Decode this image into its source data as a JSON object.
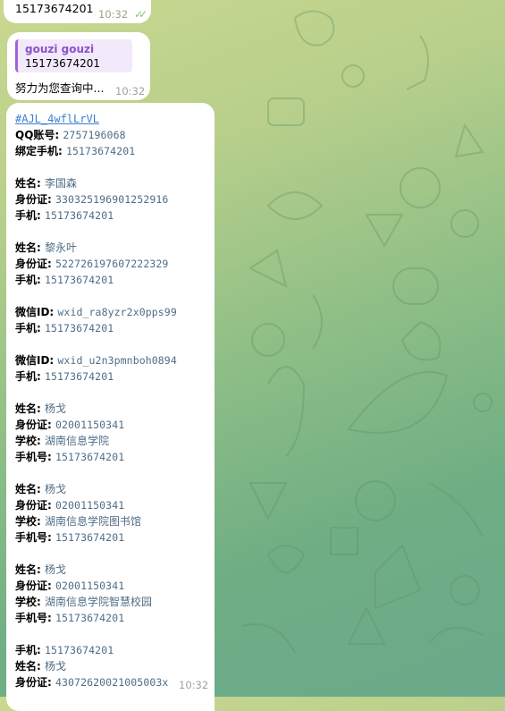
{
  "colors": {
    "accent": "#3b7fd0",
    "reply_bar": "#9d66d8",
    "reply_name": "#8b52c9",
    "value_text": "#4f6d86"
  },
  "msg1": {
    "text": "15173674201",
    "time": "10:32",
    "status_icon": "double-check-icon"
  },
  "msg2": {
    "reply_name": "gouzi gouzi",
    "reply_text": "15173674201",
    "text": "努力为您查询中...",
    "time": "10:32"
  },
  "msg3": {
    "hashtag": "#AJL_4wflLrVL",
    "time": "10:32",
    "lines": [
      {
        "label": "QQ账号: ",
        "value": "2757196068"
      },
      {
        "label": "绑定手机: ",
        "value": "15173674201"
      },
      {
        "label": "",
        "value": ""
      },
      {
        "label": "姓名: ",
        "value": "李国森"
      },
      {
        "label": "身份证: ",
        "value": "330325196901252916"
      },
      {
        "label": "手机: ",
        "value": "15173674201"
      },
      {
        "label": "",
        "value": ""
      },
      {
        "label": "姓名: ",
        "value": "黎永叶"
      },
      {
        "label": "身份证: ",
        "value": "522726197607222329"
      },
      {
        "label": "手机: ",
        "value": "15173674201"
      },
      {
        "label": "",
        "value": ""
      },
      {
        "label": "微信ID: ",
        "value": "wxid_ra8yzr2x0pps99"
      },
      {
        "label": "手机: ",
        "value": "15173674201"
      },
      {
        "label": "",
        "value": ""
      },
      {
        "label": "微信ID: ",
        "value": "wxid_u2n3pmnboh0894"
      },
      {
        "label": "手机: ",
        "value": "15173674201"
      },
      {
        "label": "",
        "value": ""
      },
      {
        "label": "姓名: ",
        "value": "杨戈"
      },
      {
        "label": "身份证: ",
        "value": "02001150341"
      },
      {
        "label": "学校: ",
        "value": "湖南信息学院"
      },
      {
        "label": "手机号: ",
        "value": "15173674201"
      },
      {
        "label": "",
        "value": ""
      },
      {
        "label": "姓名: ",
        "value": "杨戈"
      },
      {
        "label": "身份证: ",
        "value": "02001150341"
      },
      {
        "label": "学校: ",
        "value": "湖南信息学院图书馆"
      },
      {
        "label": "手机号: ",
        "value": "15173674201"
      },
      {
        "label": "",
        "value": ""
      },
      {
        "label": "姓名: ",
        "value": "杨戈"
      },
      {
        "label": "身份证: ",
        "value": "02001150341"
      },
      {
        "label": "学校: ",
        "value": "湖南信息学院智慧校园"
      },
      {
        "label": "手机号: ",
        "value": "15173674201"
      },
      {
        "label": "",
        "value": ""
      },
      {
        "label": "手机: ",
        "value": "15173674201"
      },
      {
        "label": "姓名: ",
        "value": "杨戈"
      },
      {
        "label": "身份证: ",
        "value": "43072620021005003x"
      }
    ]
  }
}
